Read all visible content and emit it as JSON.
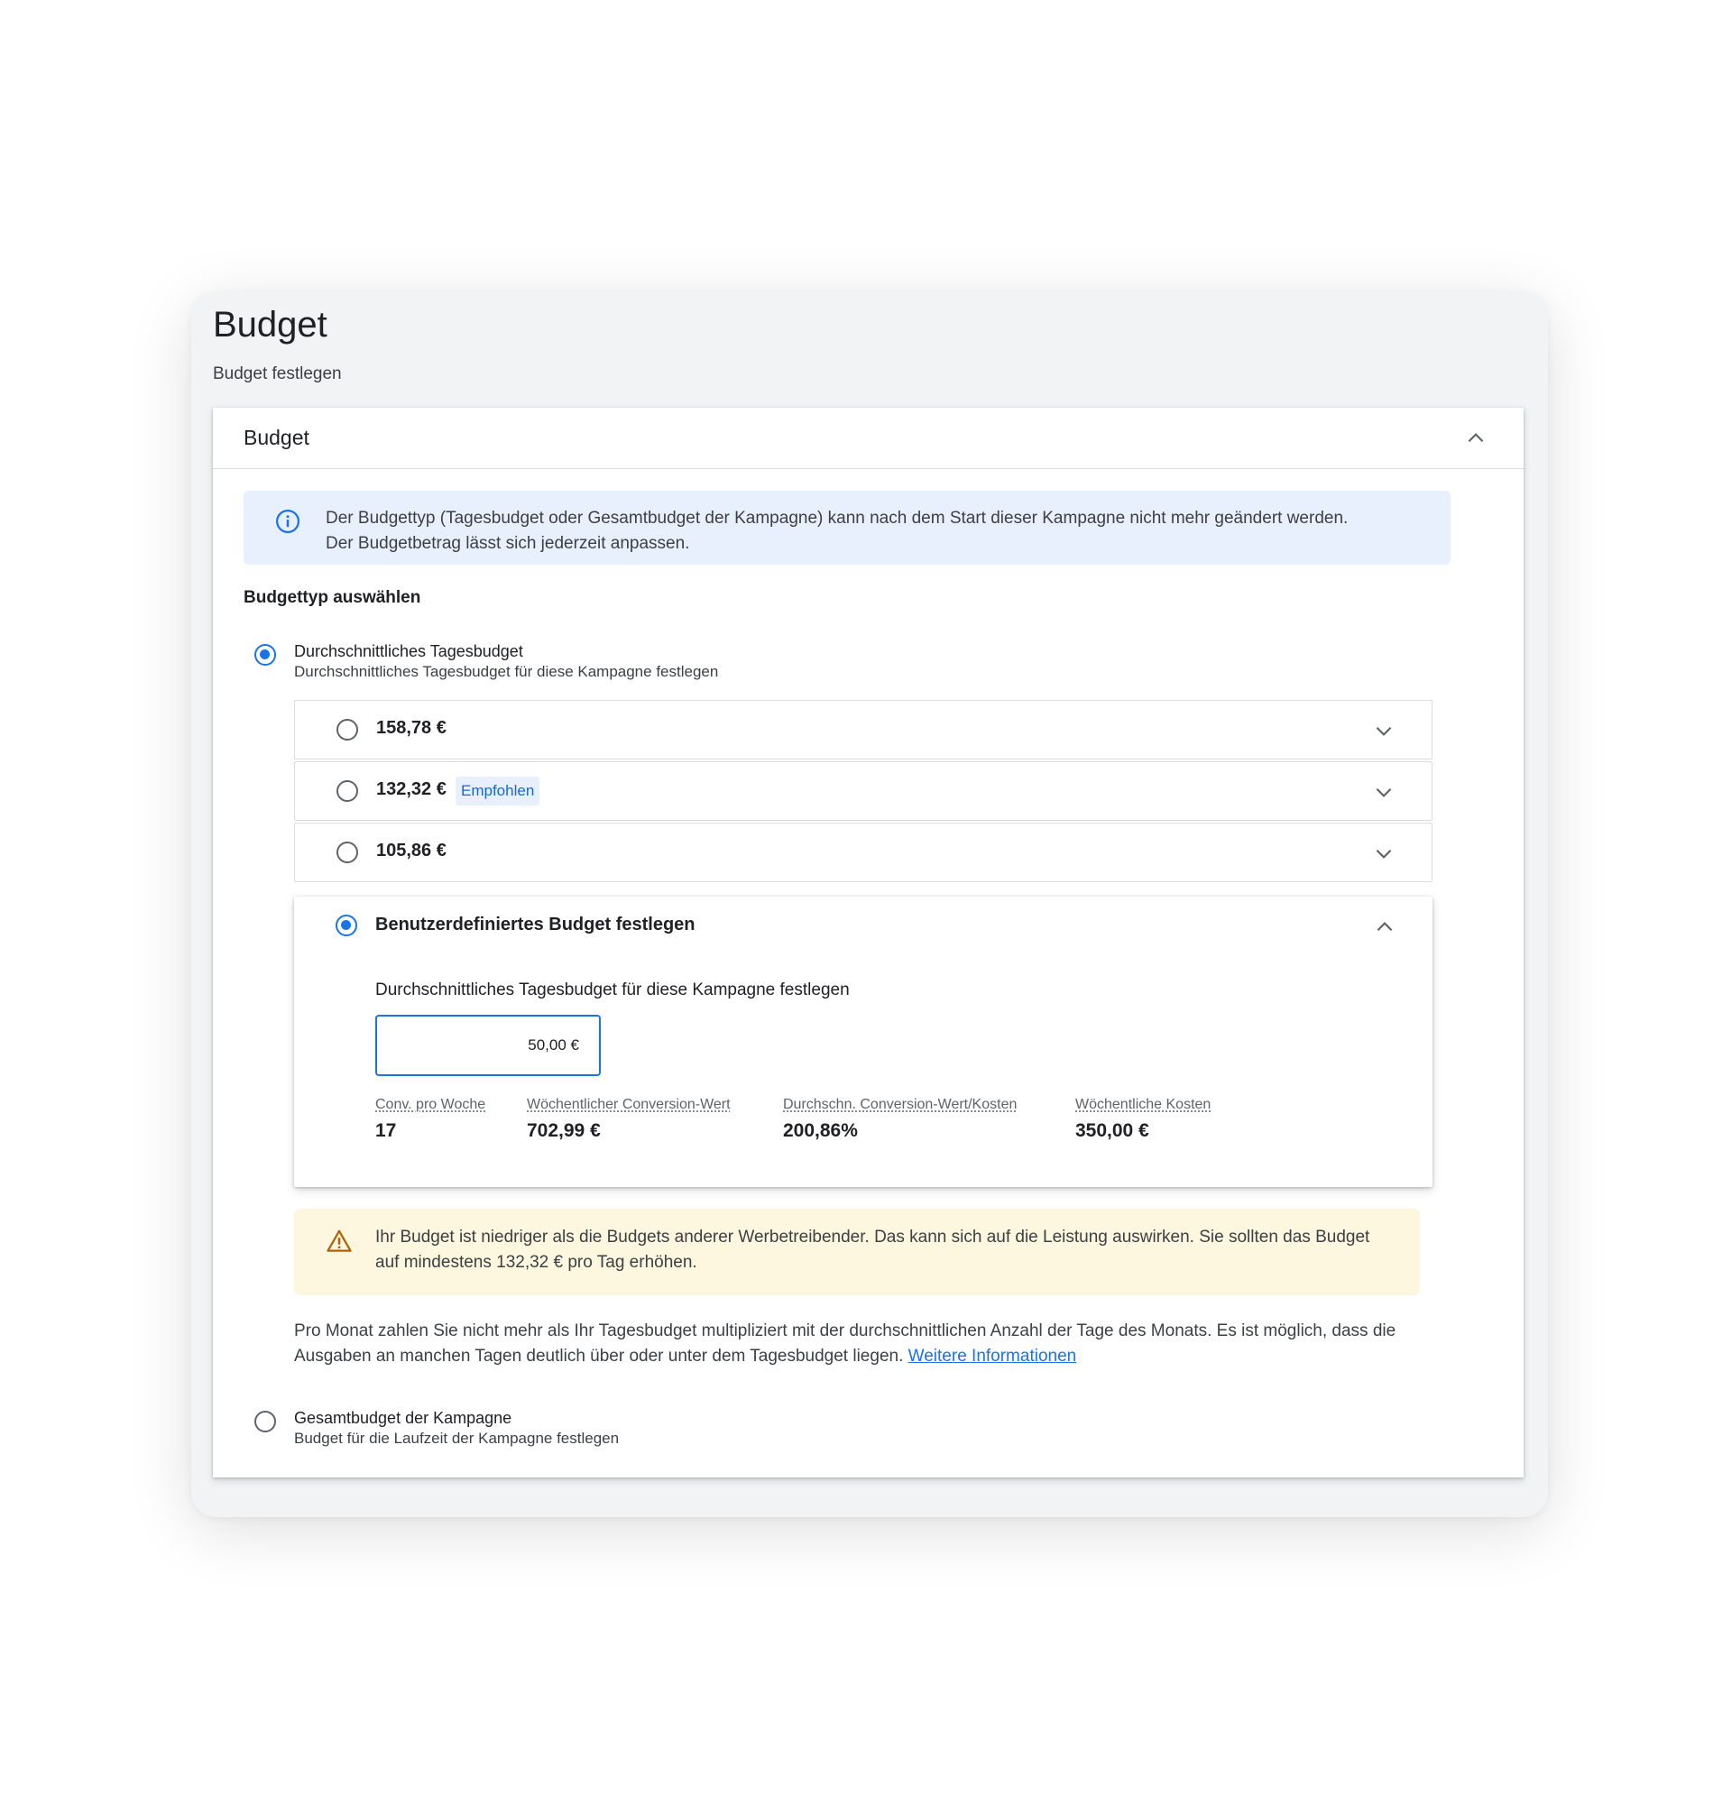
{
  "page": {
    "title": "Budget",
    "subtitle": "Budget festlegen"
  },
  "panel": {
    "title": "Budget",
    "info": {
      "icon": "info-icon",
      "line1": "Der Budgettyp (Tagesbudget oder Gesamtbudget der Kampagne) kann nach dem Start dieser Kampagne nicht mehr geändert werden.",
      "line2": "Der Budgetbetrag lässt sich jederzeit anpassen."
    },
    "section_label": "Budgettyp auswählen",
    "daily": {
      "title": "Durchschnittliches Tagesbudget",
      "description": "Durchschnittliches Tagesbudget für diese Kampagne festlegen",
      "selected": true,
      "choices": [
        {
          "amount": "158,78 €",
          "badge": "",
          "selected": false
        },
        {
          "amount": "132,32 €",
          "badge": "Empfohlen",
          "selected": false
        },
        {
          "amount": "105,86 €",
          "badge": "",
          "selected": false
        }
      ],
      "custom": {
        "title": "Benutzerdefiniertes Budget festlegen",
        "selected": true,
        "field_label": "Durchschnittliches Tagesbudget für diese Kampagne festlegen",
        "input_value": "50,00 €",
        "metrics": [
          {
            "label": "Conv. pro Woche",
            "value": "17"
          },
          {
            "label": "Wöchentlicher Conversion-Wert",
            "value": "702,99 €"
          },
          {
            "label": "Durchschn. Conversion-Wert/Kosten",
            "value": "200,86%"
          },
          {
            "label": "Wöchentliche Kosten",
            "value": "350,00 €"
          }
        ]
      },
      "warning": {
        "icon": "warning-icon",
        "text": "Ihr Budget ist niedriger als die Budgets anderer Werbetreibender. Das kann sich auf die Leistung auswirken. Sie sollten das Budget auf mindestens 132,32 € pro Tag erhöhen."
      },
      "note": {
        "text": "Pro Monat zahlen Sie nicht mehr als Ihr Tagesbudget multipliziert mit der durchschnittlichen Anzahl der Tage des Monats. Es ist möglich, dass die Ausgaben an manchen Tagen deutlich über oder unter dem Tagesbudget liegen.",
        "link": "Weitere Informationen"
      }
    },
    "total": {
      "title": "Gesamtbudget der Kampagne",
      "description": "Budget für die Laufzeit der Kampagne festlegen",
      "selected": false
    }
  },
  "colors": {
    "accent": "#1a73e8",
    "info_bg": "#e8f0fe",
    "warning_bg": "#fef7e0",
    "warning_icon": "#b06000"
  }
}
